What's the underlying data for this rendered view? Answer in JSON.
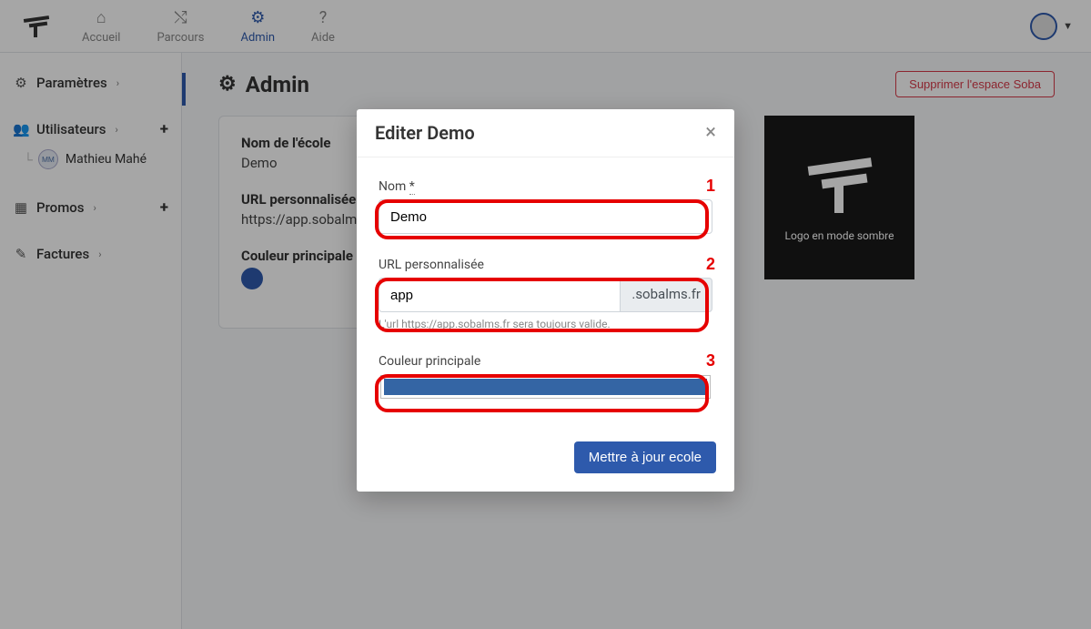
{
  "topnav": {
    "items": [
      {
        "label": "Accueil",
        "icon": "home"
      },
      {
        "label": "Parcours",
        "icon": "route"
      },
      {
        "label": "Admin",
        "icon": "gears",
        "active": true
      },
      {
        "label": "Aide",
        "icon": "question"
      }
    ]
  },
  "sidebar": {
    "params_label": "Paramètres",
    "users_label": "Utilisateurs",
    "user_name": "Mathieu Mahé",
    "user_initials": "MM",
    "promos_label": "Promos",
    "invoices_label": "Factures"
  },
  "page": {
    "title": "Admin",
    "delete_btn": "Supprimer l'espace Soba"
  },
  "info": {
    "school_name_label": "Nom de l'école",
    "school_name_value": "Demo",
    "url_label": "URL personnalisée",
    "url_value": "https://app.sobalms.fr",
    "color_label": "Couleur principale",
    "color_value": "#2e5aac"
  },
  "logo_caption": "Logo en mode sombre",
  "modal": {
    "title": "Editer Demo",
    "name_label": "Nom",
    "name_value": "Demo",
    "url_label": "URL personnalisée",
    "url_value": "app",
    "url_suffix": ".sobalms.fr",
    "url_help": "L'url https://app.sobalms.fr sera toujours valide.",
    "color_label": "Couleur principale",
    "submit": "Mettre à jour ecole"
  }
}
